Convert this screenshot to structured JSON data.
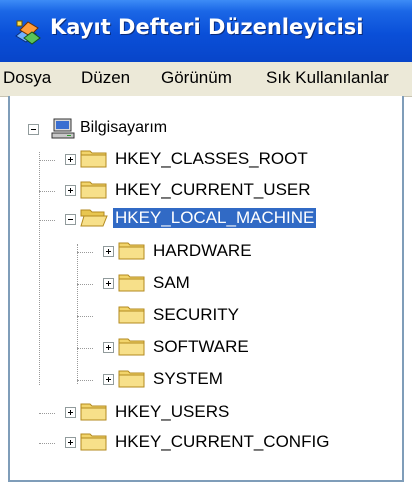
{
  "window": {
    "title": "Kayıt Defteri Düzenleyicisi",
    "icon": "registry-editor-icon"
  },
  "menu": [
    {
      "label": "Dosya"
    },
    {
      "label": "Düzen"
    },
    {
      "label": "Görünüm"
    },
    {
      "label": "Sık Kullanılanlar"
    }
  ],
  "tree": {
    "root": {
      "label": "Bilgisayarım",
      "icon": "computer-icon",
      "expanded": true
    },
    "hives": [
      {
        "label": "HKEY_CLASSES_ROOT",
        "expanded": false
      },
      {
        "label": "HKEY_CURRENT_USER",
        "expanded": false
      },
      {
        "label": "HKEY_LOCAL_MACHINE",
        "expanded": true,
        "selected": true,
        "children": [
          {
            "label": "HARDWARE",
            "expandable": true
          },
          {
            "label": "SAM",
            "expandable": true
          },
          {
            "label": "SECURITY",
            "expandable": false
          },
          {
            "label": "SOFTWARE",
            "expandable": true
          },
          {
            "label": "SYSTEM",
            "expandable": true
          }
        ]
      },
      {
        "label": "HKEY_USERS",
        "expanded": false
      },
      {
        "label": "HKEY_CURRENT_CONFIG",
        "expanded": false
      }
    ]
  },
  "colors": {
    "titlebar": "#0a4fd8",
    "selection": "#316ac5",
    "folder": "#f2d46b",
    "menubar": "#ece9d8"
  }
}
